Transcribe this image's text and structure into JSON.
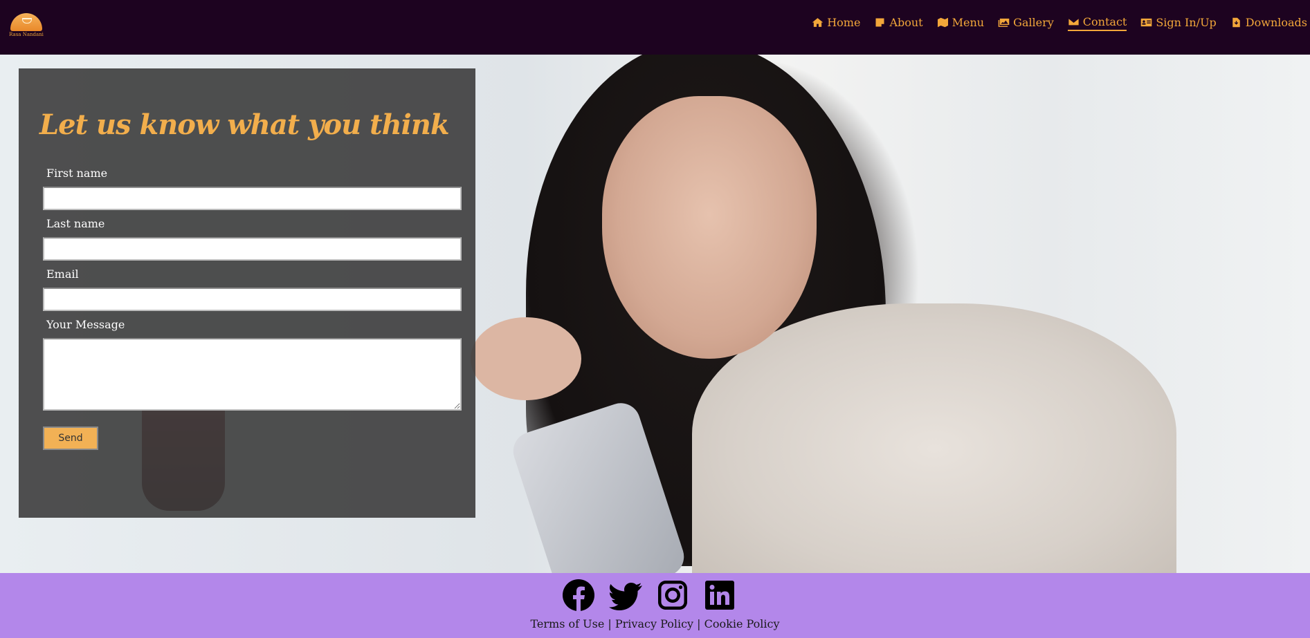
{
  "header": {
    "logo_text": "Rasa Nandani",
    "nav": [
      {
        "label": "Home",
        "icon": "home-icon"
      },
      {
        "label": "About",
        "icon": "note-icon"
      },
      {
        "label": "Menu",
        "icon": "map-icon"
      },
      {
        "label": "Gallery",
        "icon": "images-icon"
      },
      {
        "label": "Contact",
        "icon": "envelope-icon",
        "active": true
      },
      {
        "label": "Sign In/Up",
        "icon": "id-card-icon"
      },
      {
        "label": "Downloads",
        "icon": "file-download-icon"
      }
    ]
  },
  "form": {
    "title": "Let us know what you think",
    "first_name_label": "First name",
    "first_name_value": "",
    "last_name_label": "Last name",
    "last_name_value": "",
    "email_label": "Email",
    "email_value": "",
    "message_label": "Your Message",
    "message_value": "",
    "send_label": "Send"
  },
  "footer": {
    "socials": [
      "facebook-icon",
      "twitter-icon",
      "instagram-icon",
      "linkedin-icon"
    ],
    "terms": "Terms of Use",
    "privacy": "Privacy Policy",
    "cookie": "Cookie Policy",
    "separator": "|"
  },
  "colors": {
    "header_bg": "#1d0320",
    "accent": "#f2a73a",
    "footer_bg": "#b387ea",
    "panel_bg": "#383838"
  }
}
